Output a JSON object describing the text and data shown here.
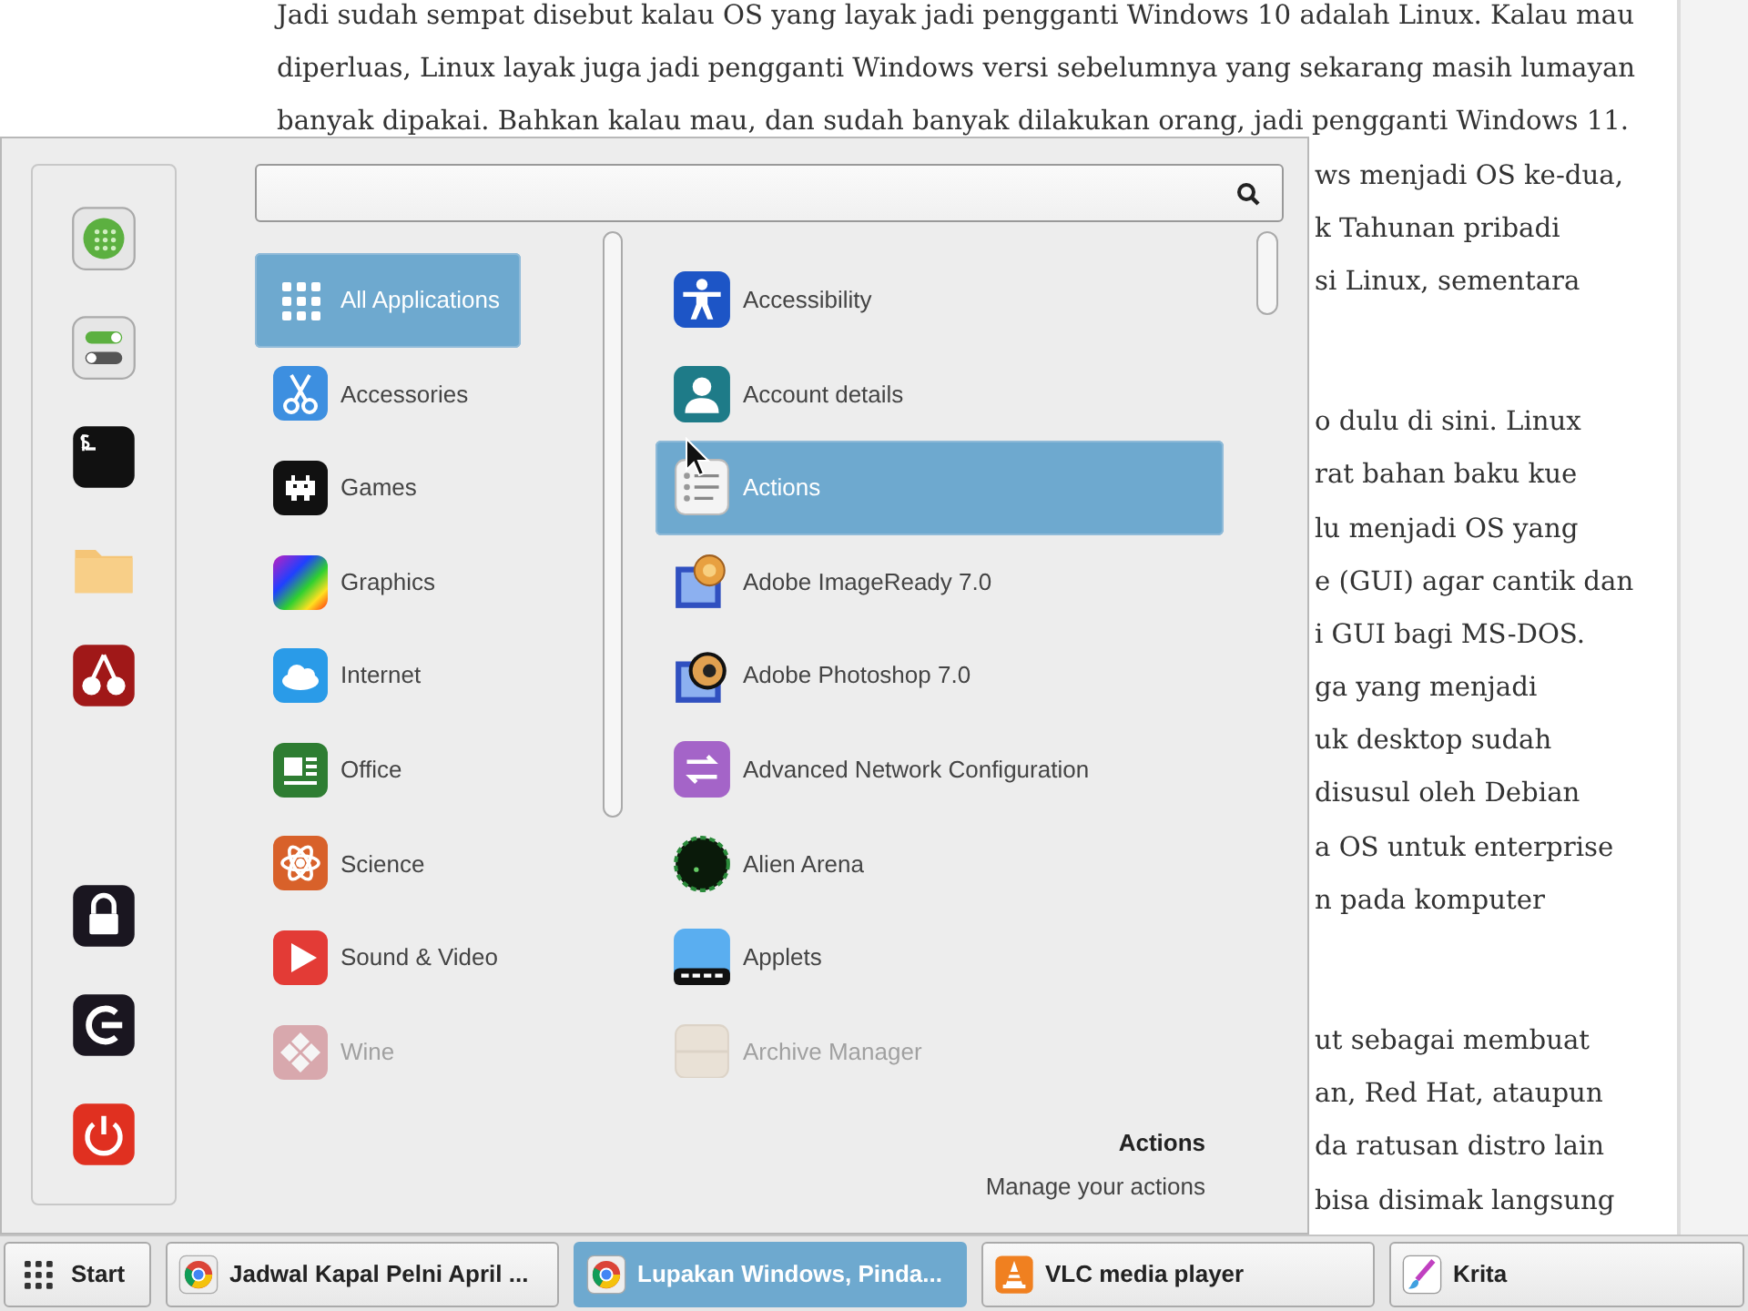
{
  "article": {
    "paragraphs": [
      {
        "lines": [
          {
            "kind": "full",
            "text": "Jadi sudah sempat disebut kalau OS yang layak jadi pengganti Windows 10 adalah Linux. Kalau mau"
          },
          {
            "kind": "full",
            "text": "diperluas, Linux layak juga jadi pengganti Windows versi sebelumnya yang sekarang masih lumayan"
          },
          {
            "kind": "full",
            "text": "banyak dipakai. Bahkan kalau mau, dan sudah banyak dilakukan orang, jadi pengganti Windows 11."
          },
          {
            "kind": "partial",
            "text": "ws menjadi OS ke-dua,"
          },
          {
            "kind": "partial",
            "text": "k Tahunan pribadi"
          },
          {
            "kind": "partial",
            "text": "si Linux, sementara"
          }
        ]
      },
      {
        "lines": [
          {
            "kind": "partial",
            "text": "o dulu di sini. Linux"
          },
          {
            "kind": "partial",
            "text": "rat bahan baku kue"
          },
          {
            "kind": "partial",
            "text": "lu menjadi OS yang"
          },
          {
            "kind": "partial",
            "text": "e (GUI) agar cantik dan"
          },
          {
            "kind": "partial",
            "text": "i GUI bagi MS-DOS."
          },
          {
            "kind": "partial",
            "text": "ga yang menjadi"
          },
          {
            "kind": "partial",
            "text": "uk desktop sudah"
          },
          {
            "kind": "partial",
            "text": "disusul oleh Debian"
          },
          {
            "kind": "partial",
            "text": "a OS untuk enterprise"
          },
          {
            "kind": "partial",
            "text": "n pada komputer"
          }
        ]
      },
      {
        "lines": [
          {
            "kind": "partial",
            "text": "ut sebagai membuat"
          },
          {
            "kind": "partial",
            "text": "an, Red Hat, ataupun"
          },
          {
            "kind": "partial",
            "text": "da ratusan distro lain"
          },
          {
            "kind": "partial",
            "text": "bisa disimak langsung"
          }
        ]
      }
    ]
  },
  "menu": {
    "categories": [
      {
        "label": "All Applications",
        "selected": true,
        "faded": false
      },
      {
        "label": "Accessories",
        "selected": false,
        "faded": false
      },
      {
        "label": "Games",
        "selected": false,
        "faded": false
      },
      {
        "label": "Graphics",
        "selected": false,
        "faded": false
      },
      {
        "label": "Internet",
        "selected": false,
        "faded": false
      },
      {
        "label": "Office",
        "selected": false,
        "faded": false
      },
      {
        "label": "Science",
        "selected": false,
        "faded": false
      },
      {
        "label": "Sound & Video",
        "selected": false,
        "faded": false
      },
      {
        "label": "Wine",
        "selected": false,
        "faded": true
      }
    ],
    "apps": [
      {
        "label": "Accessibility",
        "selected": false,
        "faded": false
      },
      {
        "label": "Account details",
        "selected": false,
        "faded": false
      },
      {
        "label": "Actions",
        "selected": true,
        "faded": false
      },
      {
        "label": "Adobe ImageReady 7.0",
        "selected": false,
        "faded": false
      },
      {
        "label": "Adobe Photoshop 7.0",
        "selected": false,
        "faded": false
      },
      {
        "label": "Advanced Network Configuration",
        "selected": false,
        "faded": false
      },
      {
        "label": "Alien Arena",
        "selected": false,
        "faded": false
      },
      {
        "label": "Applets",
        "selected": false,
        "faded": false
      },
      {
        "label": "Archive Manager",
        "selected": false,
        "faded": true
      }
    ],
    "description": {
      "title": "Actions",
      "subtitle": "Manage your actions"
    }
  },
  "taskbar": {
    "start": "Start",
    "tasks": [
      {
        "label": "Jadwal Kapal Pelni April ...",
        "selected": false
      },
      {
        "label": "Lupakan Windows, Pinda...",
        "selected": true
      },
      {
        "label": "VLC media player",
        "selected": false
      },
      {
        "label": "Krita",
        "selected": false
      }
    ]
  }
}
